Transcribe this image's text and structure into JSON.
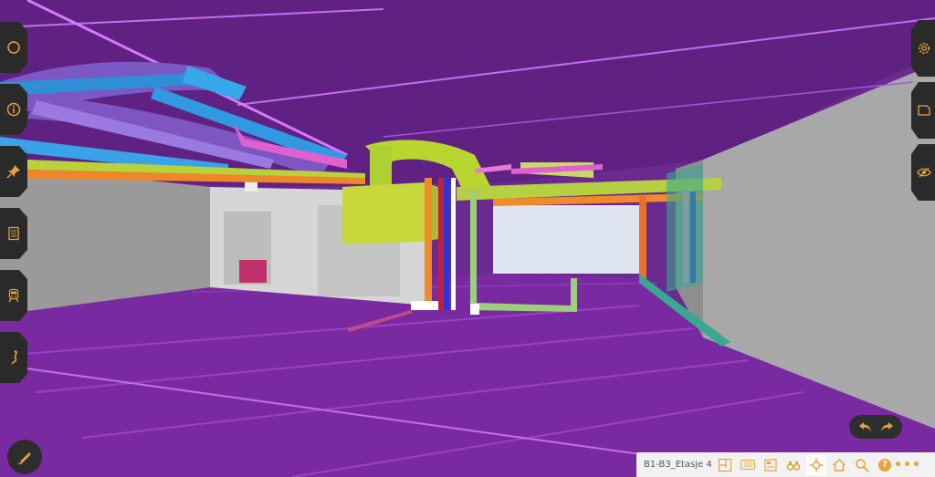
{
  "view": {
    "level_label": "B1-B3_Etasje 4",
    "background": "#6b2a8f",
    "accent": "#e8a23a"
  },
  "left_toolbar": {
    "items": [
      {
        "name": "select-icon"
      },
      {
        "name": "info-icon"
      },
      {
        "name": "pin-icon"
      },
      {
        "name": "list-icon"
      },
      {
        "name": "train-icon"
      },
      {
        "name": "measure-icon"
      }
    ]
  },
  "right_toolbar": {
    "items": [
      {
        "name": "gear-icon"
      },
      {
        "name": "sheet-icon"
      },
      {
        "name": "eye-icon"
      }
    ]
  },
  "bottom_toolbar": {
    "view_3d_label": "3D",
    "help_label": "?",
    "more_label": "•••"
  }
}
